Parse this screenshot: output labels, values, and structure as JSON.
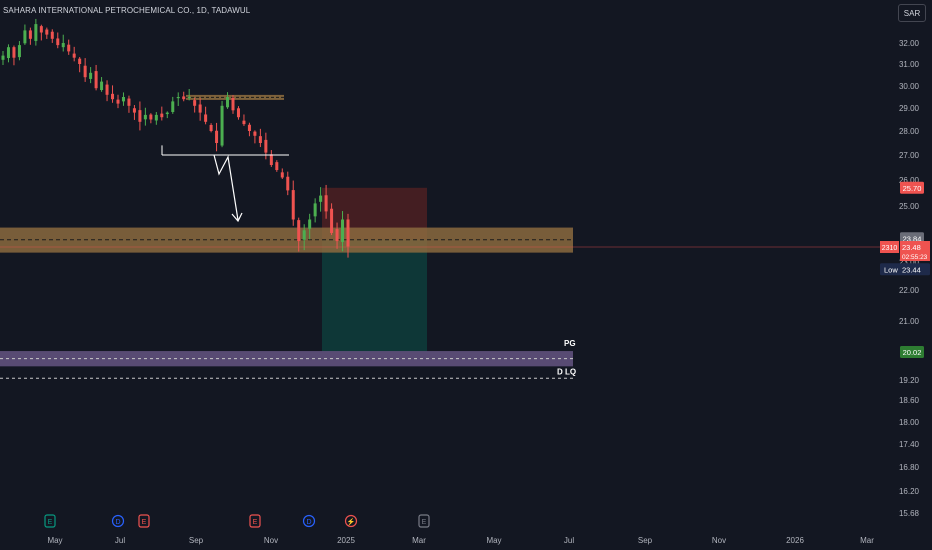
{
  "header": {
    "title": "SAHARA INTERNATIONAL PETROCHEMICAL CO., 1D, TADAWUL",
    "currency": "SAR"
  },
  "colors": {
    "background": "#131722",
    "up": "#4caf50",
    "down": "#ef5350",
    "zone": "#8b6a3e",
    "purple_zone": "#5c4e78",
    "target": "#0e3b3a",
    "stop": "#4a1f22"
  },
  "price_tags": {
    "stop": "25.70",
    "zone_top": "23.84",
    "volume": "2310",
    "last": "23.48",
    "countdown": "02:55:23",
    "low_label": "Low",
    "low": "23.44",
    "pg": "20.02"
  },
  "levels": {
    "pg_label": "PG",
    "dlq_label": "D LQ"
  },
  "events": [
    "E",
    "D",
    "E",
    "E",
    "D",
    "⚡",
    "E"
  ],
  "chart_data": {
    "type": "candlestick",
    "title": "SAHARA INTERNATIONAL PETROCHEMICAL CO., 1D, TADAWUL",
    "y_ticks": [
      32.0,
      31.0,
      30.0,
      29.0,
      28.0,
      27.0,
      26.0,
      25.0,
      23.0,
      22.0,
      21.0,
      19.2,
      18.6,
      18.0,
      17.4,
      16.8,
      16.2,
      15.68
    ],
    "x_ticks": [
      "May",
      "Jul",
      "Sep",
      "Nov",
      "2025",
      "Mar",
      "May",
      "Jul",
      "Sep",
      "Nov",
      "2026",
      "Mar"
    ],
    "series": [
      {
        "values": [
          31.4,
          31.8,
          31.3,
          31.9,
          32.6,
          32.2,
          32.9,
          32.5,
          32.4,
          32.2,
          31.9,
          32.0,
          31.6,
          31.3,
          31.0,
          30.4,
          30.6,
          29.9,
          30.2,
          29.6,
          29.4,
          29.2,
          29.5,
          29.1,
          28.8,
          28.4,
          28.7,
          28.5,
          28.7,
          28.6,
          28.8,
          29.3,
          29.5,
          29.4,
          29.5,
          29.1,
          28.8,
          28.4,
          28.0,
          27.5,
          29.1,
          29.5,
          28.9,
          28.6,
          28.3,
          28.0,
          27.8,
          27.5,
          27.1,
          26.6,
          26.4,
          26.1,
          25.6,
          24.5,
          23.7,
          24.1,
          24.5,
          25.1,
          25.4,
          24.8,
          24.0,
          23.7,
          24.5,
          23.5
        ]
      }
    ],
    "annotations": {
      "resistance_zone": [
        29.45,
        29.55
      ],
      "support_line": 27.0,
      "demand_zone": [
        23.3,
        24.2
      ],
      "long_position": {
        "entry": 23.75,
        "stop": 25.7,
        "target": 20.02
      },
      "pg_zone": [
        19.6,
        20.05
      ],
      "dlq_line": 19.25
    }
  }
}
